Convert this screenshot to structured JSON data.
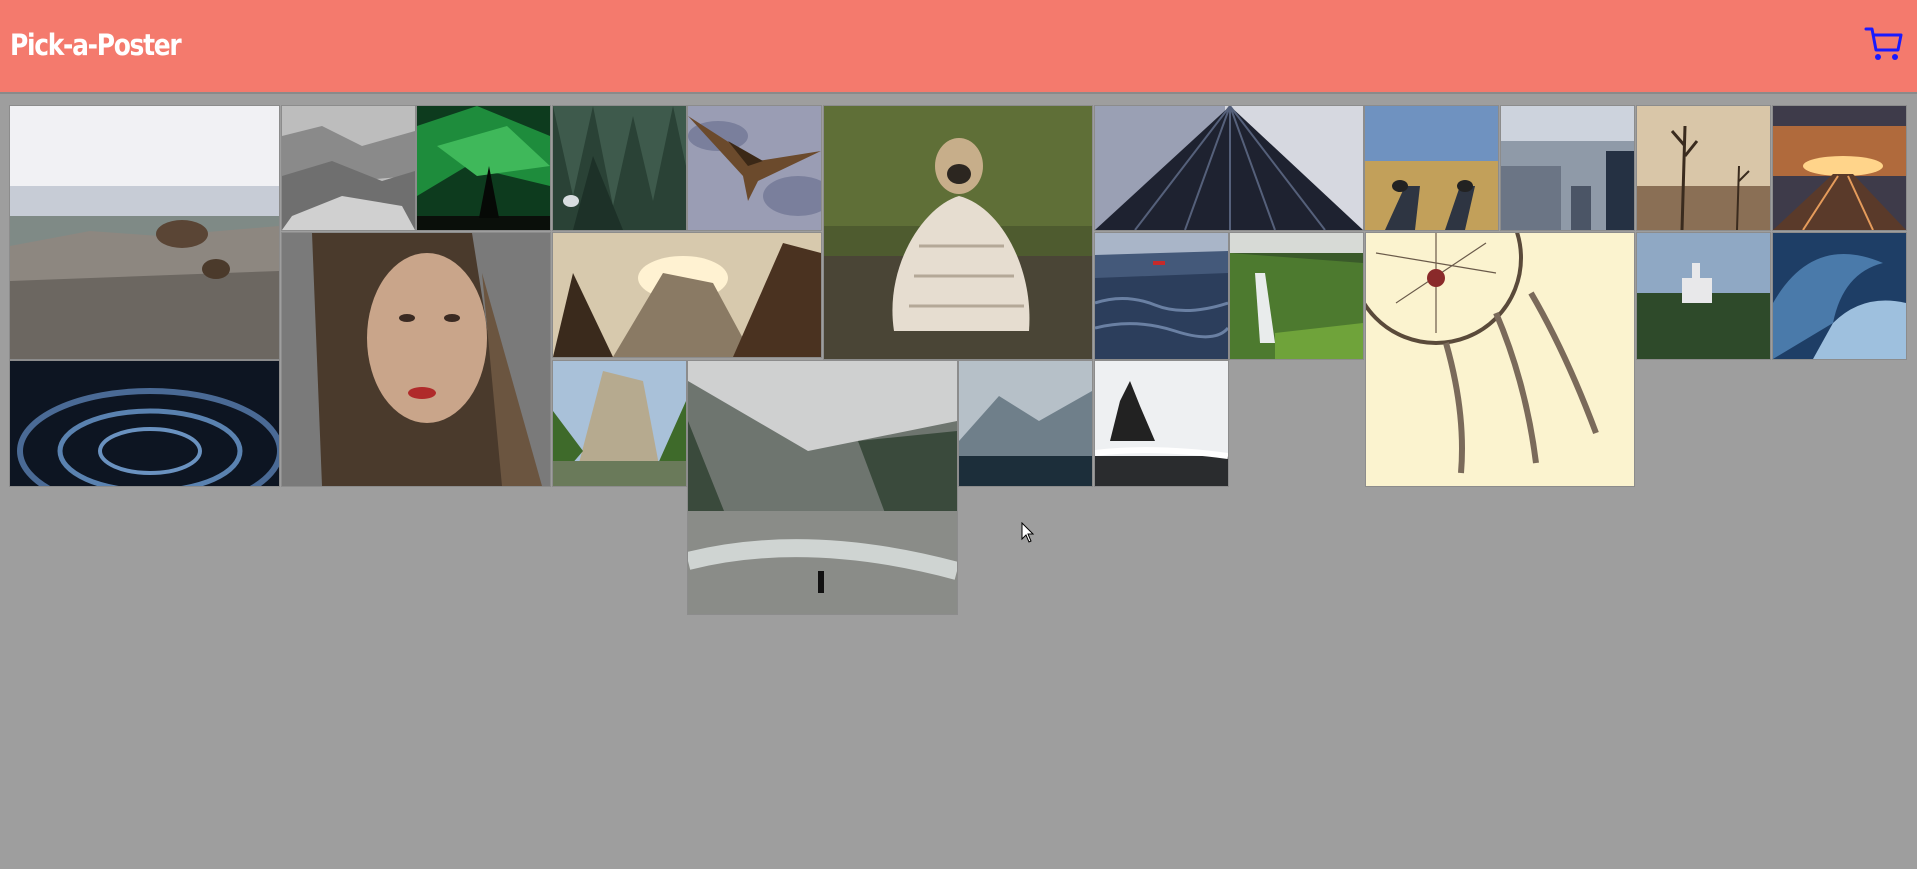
{
  "app": {
    "title": "Pick-a-Poster"
  },
  "header": {
    "cart_icon": "shopping-cart-icon",
    "cart_color": "#1a1aff",
    "bar_color": "#f47a6d"
  },
  "gallery": {
    "background": "#9e9e9e",
    "posters": [
      {
        "id": "bear-on-rocks",
        "icon": "image-thumbnail"
      },
      {
        "id": "misty-forest-grayscale",
        "icon": "image-thumbnail"
      },
      {
        "id": "northern-lights-tree",
        "icon": "image-thumbnail"
      },
      {
        "id": "pine-forest-bird",
        "icon": "image-thumbnail"
      },
      {
        "id": "eagle-flying",
        "icon": "image-thumbnail"
      },
      {
        "id": "pug-in-blanket",
        "icon": "image-thumbnail"
      },
      {
        "id": "skyscraper-looking-up",
        "icon": "image-thumbnail"
      },
      {
        "id": "feet-in-field",
        "icon": "image-thumbnail"
      },
      {
        "id": "city-skyline",
        "icon": "image-thumbnail"
      },
      {
        "id": "dead-trees-desert",
        "icon": "image-thumbnail"
      },
      {
        "id": "railway-sunset",
        "icon": "image-thumbnail"
      },
      {
        "id": "woman-portrait",
        "icon": "image-thumbnail"
      },
      {
        "id": "valley-sunrise",
        "icon": "image-thumbnail"
      },
      {
        "id": "ocean-with-boat",
        "icon": "image-thumbnail"
      },
      {
        "id": "waterfall-green",
        "icon": "image-thumbnail"
      },
      {
        "id": "dreamcatcher",
        "icon": "image-thumbnail"
      },
      {
        "id": "castle-on-hill",
        "icon": "image-thumbnail"
      },
      {
        "id": "ocean-wave",
        "icon": "image-thumbnail"
      },
      {
        "id": "star-trails",
        "icon": "image-thumbnail"
      },
      {
        "id": "yosemite-valley",
        "icon": "image-thumbnail"
      },
      {
        "id": "river-hiker",
        "icon": "image-thumbnail"
      },
      {
        "id": "misty-mountains",
        "icon": "image-thumbnail"
      },
      {
        "id": "sea-stack-beach",
        "icon": "image-thumbnail"
      }
    ]
  }
}
